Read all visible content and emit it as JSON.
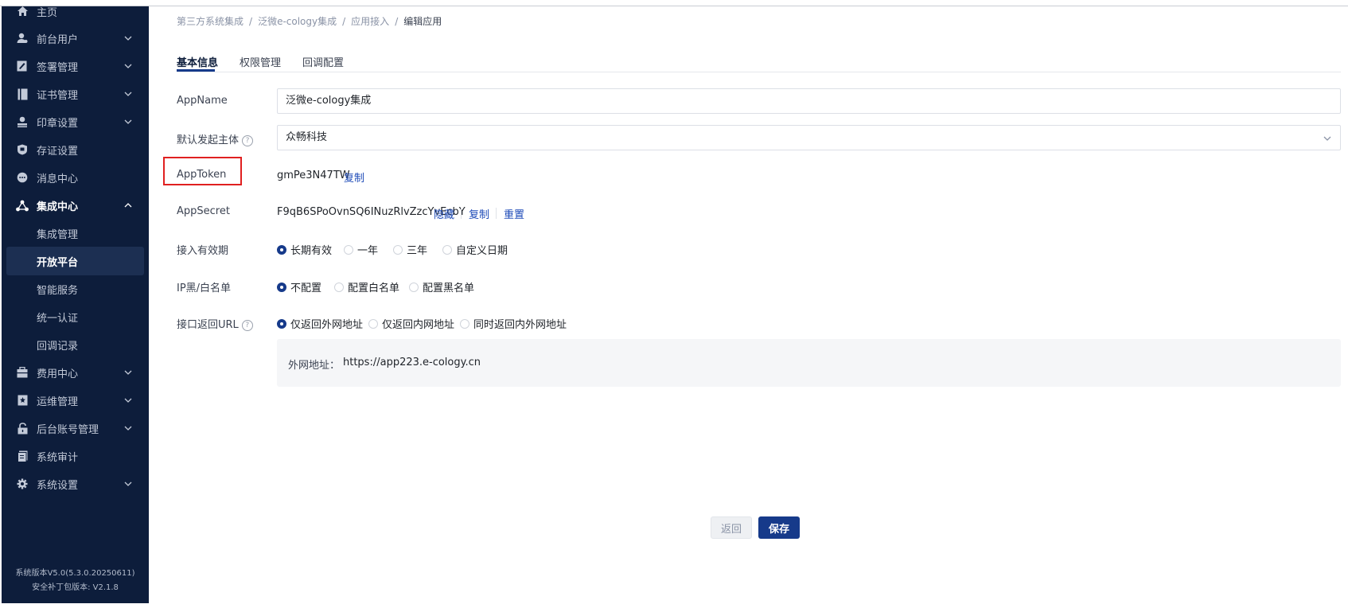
{
  "sidebar": {
    "items": [
      {
        "label": "主页",
        "icon": "home-icon"
      },
      {
        "label": "前台用户",
        "icon": "user-icon"
      },
      {
        "label": "签署管理",
        "icon": "sign-edit-icon"
      },
      {
        "label": "证书管理",
        "icon": "certificate-icon"
      },
      {
        "label": "印章设置",
        "icon": "seal-icon"
      },
      {
        "label": "存证设置",
        "icon": "evidence-icon"
      },
      {
        "label": "消息中心",
        "icon": "message-icon"
      },
      {
        "label": "集成中心",
        "icon": "integration-icon"
      },
      {
        "label": "费用中心",
        "icon": "fee-icon"
      },
      {
        "label": "运维管理",
        "icon": "bookmark-icon"
      },
      {
        "label": "后台账号管理",
        "icon": "lock-icon"
      },
      {
        "label": "系统审计",
        "icon": "audit-icon"
      },
      {
        "label": "系统设置",
        "icon": "gear-icon"
      }
    ],
    "sub_items": [
      {
        "label": "集成管理"
      },
      {
        "label": "开放平台"
      },
      {
        "label": "智能服务"
      },
      {
        "label": "统一认证"
      },
      {
        "label": "回调记录"
      }
    ],
    "version_line1": "系统版本V5.0(5.3.0.20250611)",
    "version_line2": "安全补丁包版本: V2.1.8"
  },
  "breadcrumb": {
    "items": [
      "第三方系统集成",
      "泛微e-cology集成",
      "应用接入",
      "编辑应用"
    ],
    "separator": "/"
  },
  "tabs": [
    {
      "label": "基本信息",
      "active": true
    },
    {
      "label": "权限管理",
      "active": false
    },
    {
      "label": "回调配置",
      "active": false
    }
  ],
  "form": {
    "app_name_label": "AppName",
    "app_name_value": "泛微e-cology集成",
    "initiator_label": "默认发起主体",
    "initiator_value": "众畅科技",
    "app_token_label": "AppToken",
    "app_token_value": "gmPe3N47TW",
    "copy_label": "复制",
    "app_secret_label": "AppSecret",
    "app_secret_value": "F9qB6SPoOvnSQ6INuzRlvZzcYvEcbY",
    "hide_label": "隐藏",
    "reset_label": "重置",
    "validity_label": "接入有效期",
    "validity_options": [
      "长期有效",
      "一年",
      "三年",
      "自定义日期"
    ],
    "ip_label": "IP黑/白名单",
    "ip_options": [
      "不配置",
      "配置白名单",
      "配置黑名单"
    ],
    "url_label": "接口返回URL",
    "url_options": [
      "仅返回外网地址",
      "仅返回内网地址",
      "同时返回内外网地址"
    ],
    "external_url_label": "外网地址：",
    "external_url_value": "https://app223.e-cology.cn",
    "help_glyph": "?"
  },
  "buttons": {
    "back": "返回",
    "save": "保存"
  },
  "colors": {
    "sidebar_bg": "#0d1d3b",
    "accent": "#163a8a",
    "link": "#1e4bb8",
    "highlight": "#e02020"
  }
}
